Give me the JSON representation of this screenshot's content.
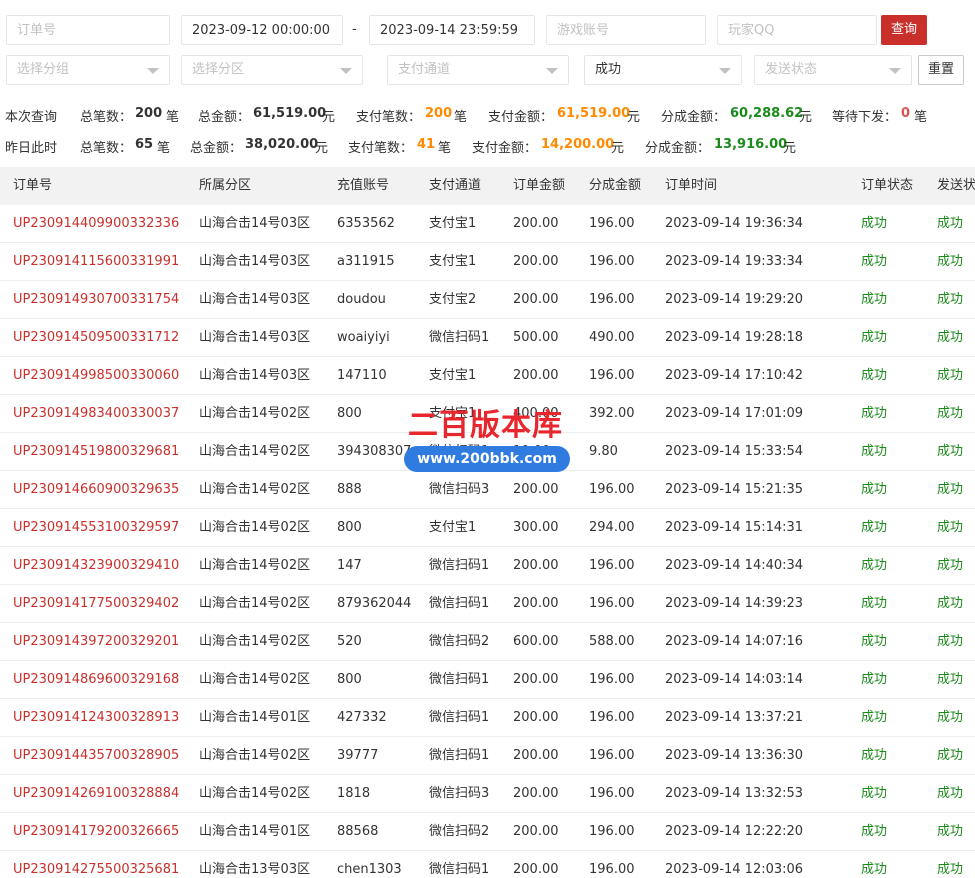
{
  "filters": {
    "order_no_placeholder": "订单号",
    "start_time": "2023-09-12 00:00:00",
    "range_separator": "-",
    "end_time": "2023-09-14 23:59:59",
    "game_account_placeholder": "游戏账号",
    "player_qq_placeholder": "玩家QQ",
    "query_label": "查询",
    "group_placeholder": "选择分组",
    "zone_placeholder": "选择分区",
    "channel_placeholder": "支付通道",
    "status_value": "成功",
    "send_status_placeholder": "发送状态",
    "reset_label": "重置"
  },
  "summary_current": {
    "title": "本次查询",
    "total_count_label": "总笔数：",
    "total_count": "200",
    "count_unit": "笔",
    "total_amount_label": "总金额：",
    "total_amount": "61,519.00",
    "amount_unit": "元",
    "pay_count_label": "支付笔数：",
    "pay_count": "200",
    "pay_amount_label": "支付金额：",
    "pay_amount": "61,519.00",
    "share_amount_label": "分成金额：",
    "share_amount": "60,288.62",
    "pending_label": "等待下发：",
    "pending": "0"
  },
  "summary_yesterday": {
    "title": "昨日此时",
    "total_count_label": "总笔数：",
    "total_count": "65",
    "count_unit": "笔",
    "total_amount_label": "总金额：",
    "total_amount": "38,020.00",
    "amount_unit": "元",
    "pay_count_label": "支付笔数：",
    "pay_count": "41",
    "pay_amount_label": "支付金额：",
    "pay_amount": "14,200.00",
    "share_amount_label": "分成金额：",
    "share_amount": "13,916.00"
  },
  "table": {
    "headers": [
      "订单号",
      "所属分区",
      "充值账号",
      "支付通道",
      "订单金额",
      "分成金额",
      "订单时间",
      "订单状态",
      "发送状态"
    ],
    "rows": [
      [
        "UP230914409900332336",
        "山海合击14号03区",
        "6353562",
        "支付宝1",
        "200.00",
        "196.00",
        "2023-09-14 19:36:34",
        "成功",
        "成功"
      ],
      [
        "UP230914115600331991",
        "山海合击14号03区",
        "a311915",
        "支付宝1",
        "200.00",
        "196.00",
        "2023-09-14 19:33:34",
        "成功",
        "成功"
      ],
      [
        "UP230914930700331754",
        "山海合击14号03区",
        "doudou",
        "支付宝2",
        "200.00",
        "196.00",
        "2023-09-14 19:29:20",
        "成功",
        "成功"
      ],
      [
        "UP230914509500331712",
        "山海合击14号03区",
        "woaiyiyi",
        "微信扫码1",
        "500.00",
        "490.00",
        "2023-09-14 19:28:18",
        "成功",
        "成功"
      ],
      [
        "UP230914998500330060",
        "山海合击14号03区",
        "147110",
        "支付宝1",
        "200.00",
        "196.00",
        "2023-09-14 17:10:42",
        "成功",
        "成功"
      ],
      [
        "UP230914983400330037",
        "山海合击14号02区",
        "800",
        "支付宝1",
        "400.00",
        "392.00",
        "2023-09-14 17:01:09",
        "成功",
        "成功"
      ],
      [
        "UP230914519800329681",
        "山海合击14号02区",
        "394308307",
        "微信扫码1",
        "10.00",
        "9.80",
        "2023-09-14 15:33:54",
        "成功",
        "成功"
      ],
      [
        "UP230914660900329635",
        "山海合击14号02区",
        "888",
        "微信扫码3",
        "200.00",
        "196.00",
        "2023-09-14 15:21:35",
        "成功",
        "成功"
      ],
      [
        "UP230914553100329597",
        "山海合击14号02区",
        "800",
        "支付宝1",
        "300.00",
        "294.00",
        "2023-09-14 15:14:31",
        "成功",
        "成功"
      ],
      [
        "UP230914323900329410",
        "山海合击14号02区",
        "147",
        "微信扫码1",
        "200.00",
        "196.00",
        "2023-09-14 14:40:34",
        "成功",
        "成功"
      ],
      [
        "UP230914177500329402",
        "山海合击14号02区",
        "879362044",
        "微信扫码1",
        "200.00",
        "196.00",
        "2023-09-14 14:39:23",
        "成功",
        "成功"
      ],
      [
        "UP230914397200329201",
        "山海合击14号02区",
        "520",
        "微信扫码2",
        "600.00",
        "588.00",
        "2023-09-14 14:07:16",
        "成功",
        "成功"
      ],
      [
        "UP230914869600329168",
        "山海合击14号02区",
        "800",
        "微信扫码1",
        "200.00",
        "196.00",
        "2023-09-14 14:03:14",
        "成功",
        "成功"
      ],
      [
        "UP230914124300328913",
        "山海合击14号01区",
        "427332",
        "微信扫码1",
        "200.00",
        "196.00",
        "2023-09-14 13:37:21",
        "成功",
        "成功"
      ],
      [
        "UP230914435700328905",
        "山海合击14号02区",
        "39777",
        "微信扫码1",
        "200.00",
        "196.00",
        "2023-09-14 13:36:30",
        "成功",
        "成功"
      ],
      [
        "UP230914269100328884",
        "山海合击14号02区",
        "1818",
        "微信扫码3",
        "200.00",
        "196.00",
        "2023-09-14 13:32:53",
        "成功",
        "成功"
      ],
      [
        "UP230914179200326665",
        "山海合击14号01区",
        "88568",
        "微信扫码2",
        "200.00",
        "196.00",
        "2023-09-14 12:22:20",
        "成功",
        "成功"
      ],
      [
        "UP230914275500325681",
        "山海合击13号03区",
        "chen1303",
        "微信扫码1",
        "200.00",
        "196.00",
        "2023-09-14 12:03:06",
        "成功",
        "成功"
      ]
    ]
  },
  "watermark": {
    "title": "二百版本库",
    "url": "www.200bbk.com"
  },
  "colors": {
    "primary_button": "#c9302c",
    "order_link": "#c9302c",
    "success": "#1a8a1a",
    "highlight_orange": "#ff8a00",
    "highlight_green": "#1a8a1a",
    "header_bg": "#f2f2f2"
  },
  "icons": {
    "select_caret": "chevron-down-icon"
  }
}
